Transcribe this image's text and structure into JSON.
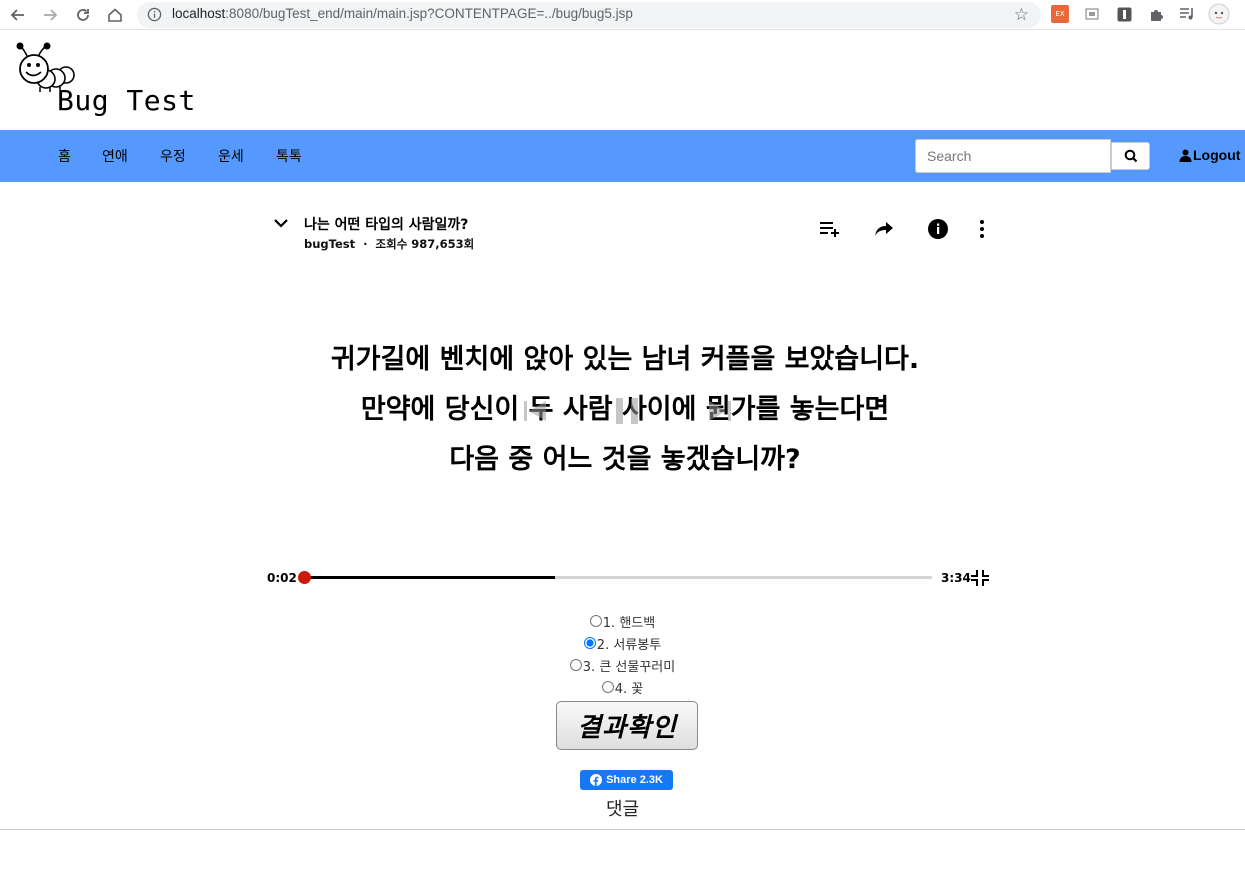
{
  "browser": {
    "url_host": "localhost",
    "url_rest": ":8080/bugTest_end/main/main.jsp?CONTENTPAGE=../bug/bug5.jsp",
    "extension_ex_label": "EX"
  },
  "site": {
    "logo_text": "Bug Test",
    "nav": [
      "홈",
      "연애",
      "우정",
      "운세",
      "톡톡"
    ],
    "search_placeholder": "Search",
    "logout_label": "Logout"
  },
  "video": {
    "title": "나는 어떤 타입의 사람일까?",
    "channel": "bugTest",
    "separator": "·",
    "views": "조회수 987,653회",
    "question_lines": [
      "귀가길에 벤치에 앉아 있는 남녀 커플을 보았습니다.",
      "만약에 당신이 두 사람 사이에 뭔가를 놓는다면",
      "다음 중 어느 것을 놓겠습니까?"
    ],
    "time_current": "0:02",
    "time_duration": "3:34",
    "progress": 0.4
  },
  "quiz": {
    "options": [
      "1. 핸드백",
      "2. 서류봉투",
      "3. 큰 선물꾸러미",
      "4. 꽃"
    ],
    "selected_index": 1,
    "result_button": "결과확인"
  },
  "social": {
    "share_label": "Share 2.3K",
    "comments_label": "댓글"
  }
}
